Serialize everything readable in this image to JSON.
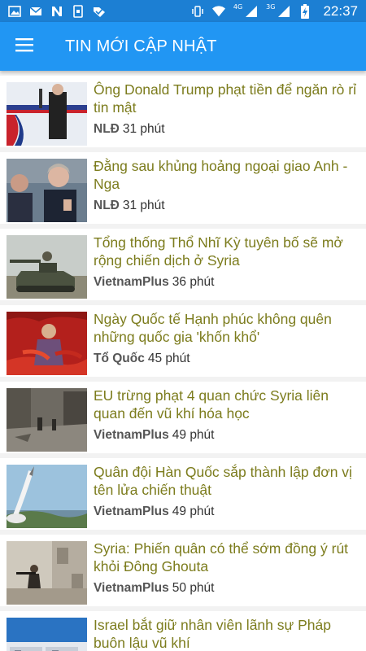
{
  "status_bar": {
    "time": "22:37",
    "network_1": "4G",
    "network_2": "3G",
    "left_icons": [
      "photo-icon",
      "mail-icon",
      "n-app-icon",
      "phone-lock-icon",
      "check-tag-icon"
    ],
    "right_icons": [
      "vibrate-icon",
      "wifi-icon",
      "signal-icon",
      "signal-icon",
      "battery-charging-icon"
    ]
  },
  "app_bar": {
    "title": "TIN MỚI CẬP NHẬT",
    "menu_icon": "hamburger-menu-icon",
    "color": "#2196f3"
  },
  "news": [
    {
      "title": "Ông Donald Trump phạt tiền để ngăn rò rỉ tin mật",
      "source": "NLĐ",
      "time": "31 phút"
    },
    {
      "title": "Đằng sau khủng hoảng ngoại giao Anh - Nga",
      "source": "NLĐ",
      "time": "31 phút"
    },
    {
      "title": "Tổng thống Thổ Nhĩ Kỳ tuyên bố sẽ mở rộng chiến dịch ở Syria",
      "source": "VietnamPlus",
      "time": "36 phút"
    },
    {
      "title": "Ngày Quốc tế Hạnh phúc không quên những quốc gia 'khốn khổ'",
      "source": "Tổ Quốc",
      "time": "45 phút"
    },
    {
      "title": "EU trừng phạt 4 quan chức Syria liên quan đến vũ khí hóa học",
      "source": "VietnamPlus",
      "time": "49 phút"
    },
    {
      "title": "Quân đội Hàn Quốc sắp thành lập đơn vị tên lửa chiến thuật",
      "source": "VietnamPlus",
      "time": "49 phút"
    },
    {
      "title": "Syria: Phiến quân có thể sớm đồng ý rút khỏi Đông Ghouta",
      "source": "VietnamPlus",
      "time": "50 phút"
    },
    {
      "title": "Israel bắt giữ nhân viên lãnh sự Pháp buôn lậu vũ khí",
      "source": "",
      "time": ""
    }
  ],
  "colors": {
    "title_text": "#7c7c1d",
    "status_bar": "#1c7fd3"
  }
}
